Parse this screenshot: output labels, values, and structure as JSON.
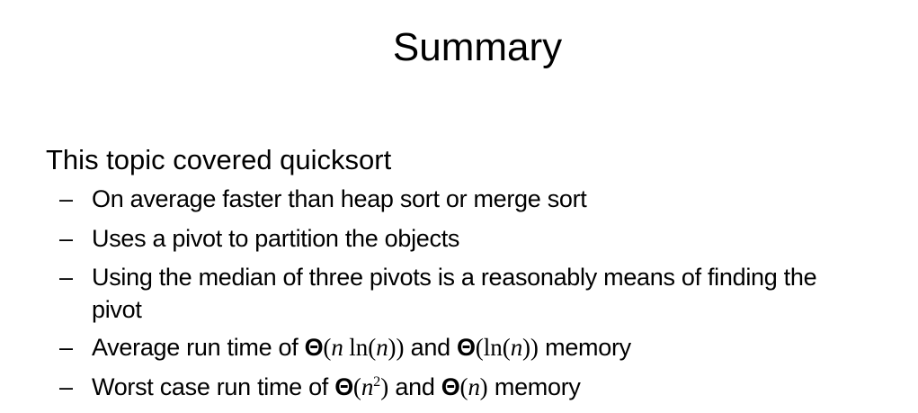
{
  "slide": {
    "title": "Summary",
    "intro": "This topic covered quicksort",
    "dash": "–",
    "bullets": [
      {
        "text": "On average faster than heap sort or merge sort"
      },
      {
        "text": "Uses a pivot to partition the objects"
      },
      {
        "line1": "Using the median of three pivots is a reasonably means of finding the",
        "line2": "pivot"
      },
      {
        "prefix": "Average run time of ",
        "theta1": "Θ",
        "arg1_open": "(",
        "arg1_n": "n",
        "arg1_ln": " ln(",
        "arg1_n2": "n",
        "arg1_close": "))",
        "mid": " and ",
        "theta2": "Θ",
        "arg2_open": "(ln(",
        "arg2_n": "n",
        "arg2_close": "))",
        "suffix": " memory"
      },
      {
        "prefix": "Worst case run time of ",
        "theta1": "Θ",
        "arg1_open": "(",
        "arg1_n": "n",
        "arg1_exp": "2",
        "arg1_close": ")",
        "mid": " and ",
        "theta2": "Θ",
        "arg2_open": "(",
        "arg2_n": "n",
        "arg2_close": ")",
        "suffix": " memory"
      }
    ]
  }
}
